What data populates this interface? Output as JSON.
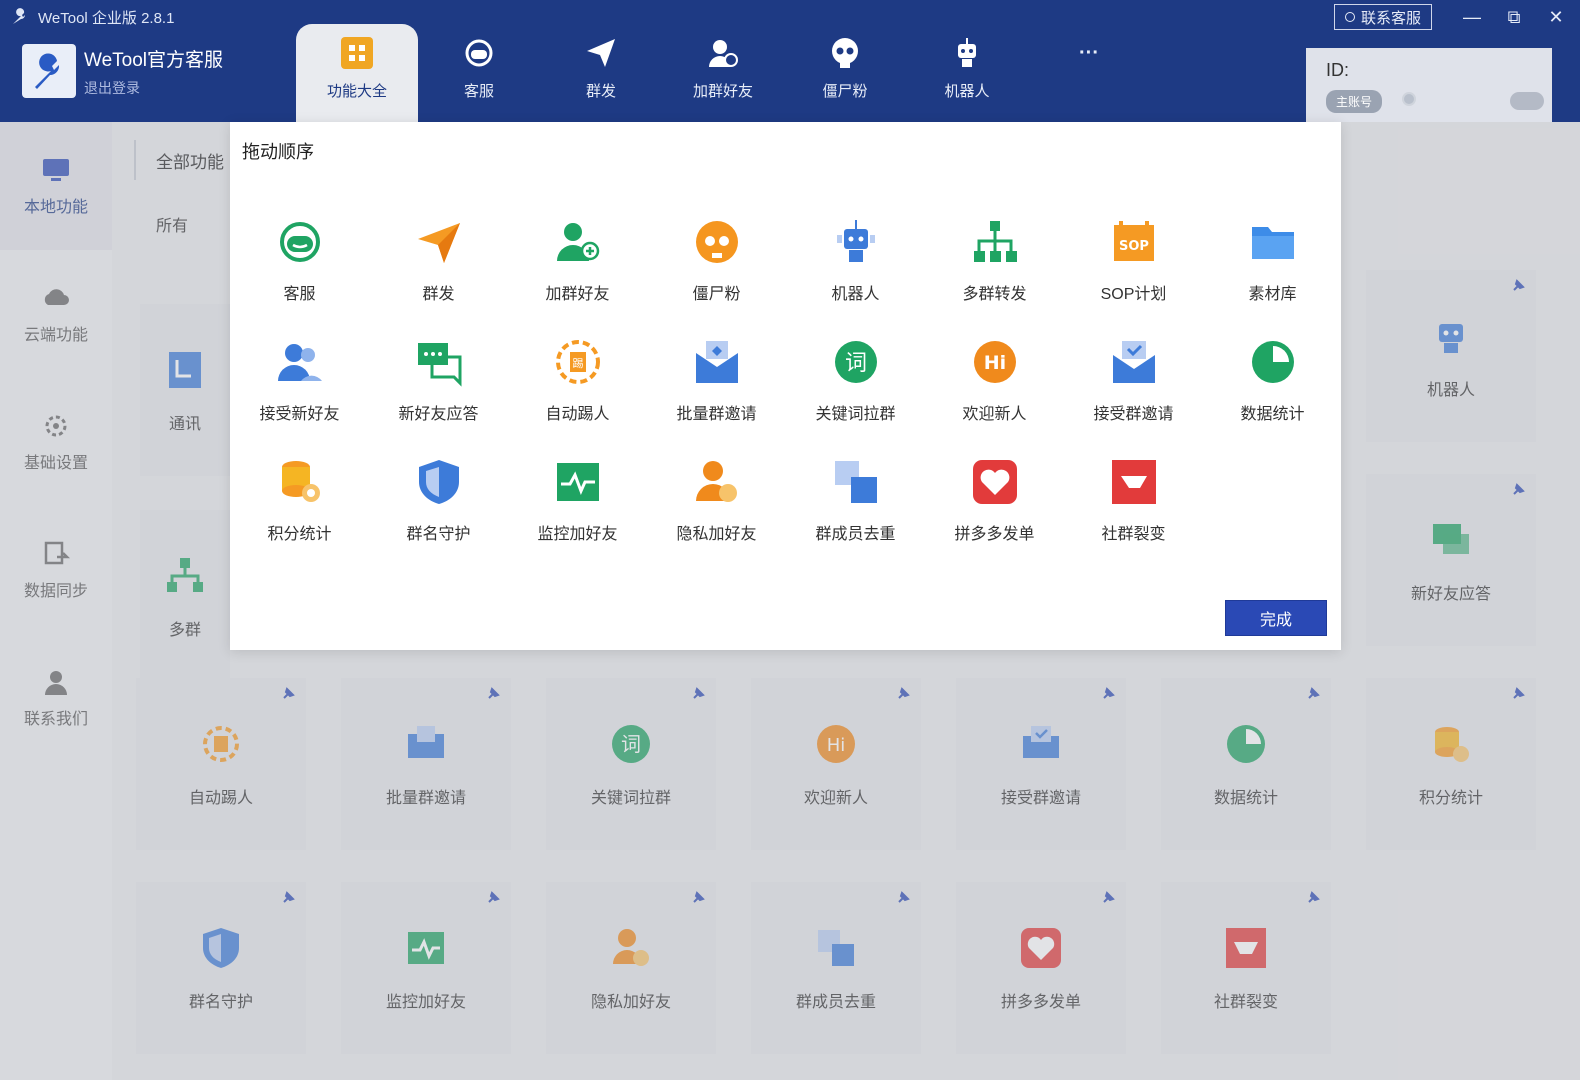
{
  "app": {
    "title": "WeTool 企业版 2.8.1"
  },
  "window": {
    "contact_label": "联系客服",
    "minimize": "—",
    "restore": "⧉",
    "close": "✕"
  },
  "account": {
    "name": "WeTool官方客服",
    "logout": "退出登录"
  },
  "topnav": [
    {
      "label": "功能大全",
      "icon": "grid-icon",
      "active": true
    },
    {
      "label": "客服",
      "icon": "headset-icon"
    },
    {
      "label": "群发",
      "icon": "paper-plane-icon"
    },
    {
      "label": "加群好友",
      "icon": "add-user-icon"
    },
    {
      "label": "僵尸粉",
      "icon": "skull-icon"
    },
    {
      "label": "机器人",
      "icon": "robot-icon"
    },
    {
      "label": "···",
      "icon": "more-icon"
    }
  ],
  "id_panel": {
    "label": "ID:",
    "badge": "主账号"
  },
  "sidebar": [
    {
      "label": "本地功能",
      "icon": "monitor-icon",
      "active": true
    },
    {
      "label": "云端功能",
      "icon": "cloud-icon"
    },
    {
      "label": "基础设置",
      "icon": "settings-icon"
    },
    {
      "label": "数据同步",
      "icon": "sync-icon"
    },
    {
      "label": "联系我们",
      "icon": "person-icon"
    }
  ],
  "main": {
    "tab": "全部功能",
    "filter": "所有",
    "cards_partial": [
      "通讯",
      "多群"
    ],
    "cards": [
      {
        "label": "机器人",
        "icon": "robot-icon"
      },
      {
        "label": "新好友应答",
        "icon": "chat-icon"
      },
      {
        "label": "自动踢人",
        "icon": "kick-icon"
      },
      {
        "label": "批量群邀请",
        "icon": "invite-icon"
      },
      {
        "label": "关键词拉群",
        "icon": "keyword-icon"
      },
      {
        "label": "欢迎新人",
        "icon": "hi-icon"
      },
      {
        "label": "接受群邀请",
        "icon": "accept-invite-icon"
      },
      {
        "label": "数据统计",
        "icon": "pie-icon"
      },
      {
        "label": "积分统计",
        "icon": "coins-icon"
      },
      {
        "label": "群名守护",
        "icon": "shield-icon"
      },
      {
        "label": "监控加好友",
        "icon": "monitor-chart-icon"
      },
      {
        "label": "隐私加好友",
        "icon": "private-user-icon"
      },
      {
        "label": "群成员去重",
        "icon": "dedupe-icon"
      },
      {
        "label": "拼多多发单",
        "icon": "pdd-icon"
      },
      {
        "label": "社群裂变",
        "icon": "fission-icon"
      }
    ]
  },
  "modal": {
    "title": "拖动顺序",
    "done_label": "完成",
    "tiles": [
      {
        "label": "客服",
        "icon": "headset-icon"
      },
      {
        "label": "群发",
        "icon": "paper-plane-icon"
      },
      {
        "label": "加群好友",
        "icon": "add-user-icon"
      },
      {
        "label": "僵尸粉",
        "icon": "skull-icon"
      },
      {
        "label": "机器人",
        "icon": "robot-icon"
      },
      {
        "label": "多群转发",
        "icon": "org-chart-icon"
      },
      {
        "label": "SOP计划",
        "icon": "sop-icon"
      },
      {
        "label": "素材库",
        "icon": "folder-icon"
      },
      {
        "label": "接受新好友",
        "icon": "users-icon"
      },
      {
        "label": "新好友应答",
        "icon": "chat-icon"
      },
      {
        "label": "自动踢人",
        "icon": "kick-icon"
      },
      {
        "label": "批量群邀请",
        "icon": "invite-icon"
      },
      {
        "label": "关键词拉群",
        "icon": "keyword-icon"
      },
      {
        "label": "欢迎新人",
        "icon": "hi-icon"
      },
      {
        "label": "接受群邀请",
        "icon": "accept-invite-icon"
      },
      {
        "label": "数据统计",
        "icon": "pie-icon"
      },
      {
        "label": "积分统计",
        "icon": "coins-icon"
      },
      {
        "label": "群名守护",
        "icon": "shield-icon"
      },
      {
        "label": "监控加好友",
        "icon": "monitor-chart-icon"
      },
      {
        "label": "隐私加好友",
        "icon": "private-user-icon"
      },
      {
        "label": "群成员去重",
        "icon": "dedupe-icon"
      },
      {
        "label": "拼多多发单",
        "icon": "pdd-icon"
      },
      {
        "label": "社群裂变",
        "icon": "fission-icon"
      }
    ]
  },
  "colors": {
    "header": "#1e3a84",
    "accent": "#2a49b5",
    "green": "#1fa463",
    "orange": "#f59a23",
    "blue": "#3d7bd9",
    "red": "#e23b3b"
  }
}
